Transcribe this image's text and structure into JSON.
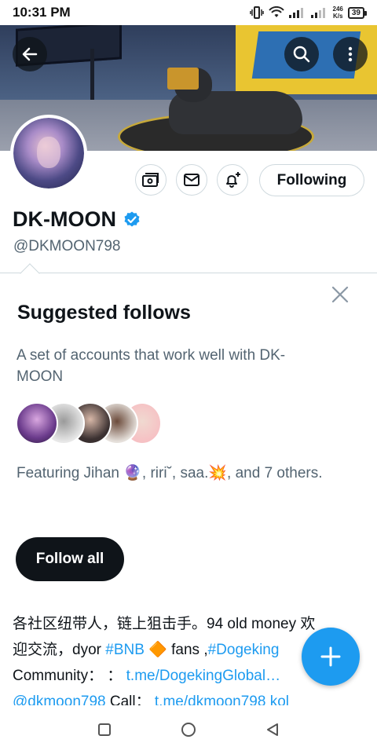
{
  "status_bar": {
    "time": "10:31 PM",
    "net_speed_value": "246",
    "net_speed_unit": "K/s",
    "battery": "39"
  },
  "profile": {
    "display_name": "DK-MOON",
    "handle": "@DKMOON798",
    "verified": true,
    "following_label": "Following"
  },
  "suggested_follows": {
    "title": "Suggested follows",
    "description": "A set of accounts that work well with DK-MOON",
    "featuring_prefix": "Featuring Jihan ",
    "featuring_emoji_1": "🔮",
    "featuring_mid": ", riri˘, saa.",
    "featuring_emoji_2": "💥",
    "featuring_suffix": ", and 7 others.",
    "follow_all_label": "Follow all"
  },
  "bio": {
    "line1": "各社区纽带人，链上狙击手。94 old money 欢",
    "line2_a": "迎交流，dyor ",
    "hashtag_bnb": "#BNB",
    "bnb_emoji": "🔶",
    "line2_b": " fans ,",
    "hashtag_dogeking": "#Dogeking",
    "line3_a": "Community： ：",
    "link_telegram": "t.me/DogekingGlobal…",
    "line3_b": " ",
    "mention": "@dkmoon798",
    "line4_a": " Call：",
    "link_call": "t.me/dkmoon798 kol"
  },
  "colors": {
    "accent": "#1d9bf0",
    "text_primary": "#0f1419",
    "text_secondary": "#536471",
    "border": "#cfd9de"
  }
}
